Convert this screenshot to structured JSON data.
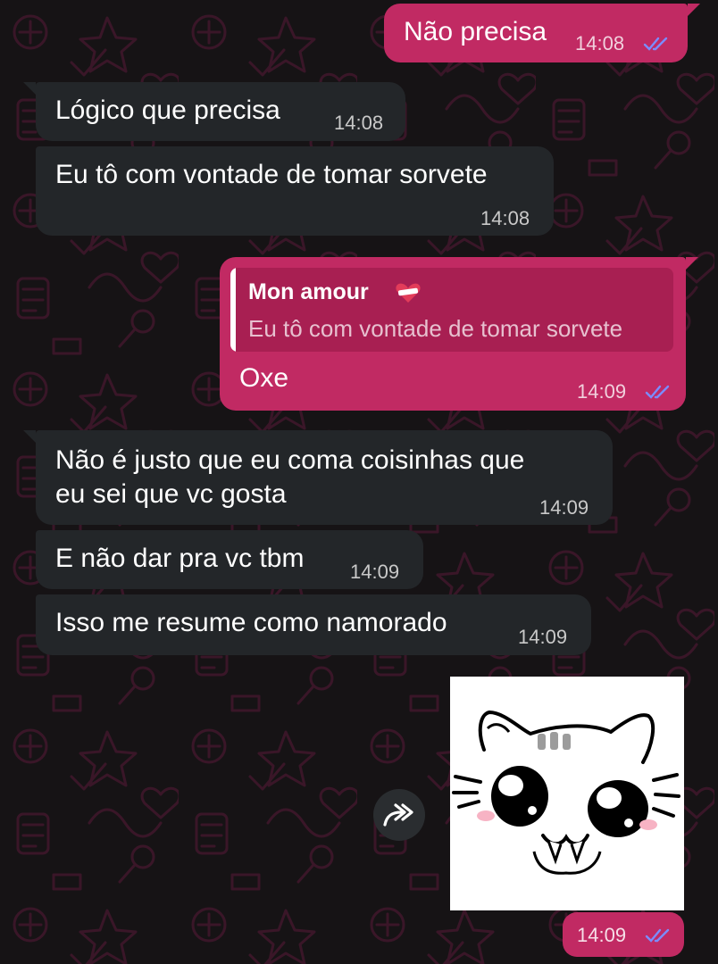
{
  "theme": {
    "incoming_bubble": "#232629",
    "outgoing_bubble": "#c12a63",
    "quote_background": "#a81f52",
    "read_ticks": "#7b8cff",
    "wallpaper_pattern": "#3a1628"
  },
  "messages": [
    {
      "direction": "outgoing",
      "text": "Não precisa",
      "time": "14:08",
      "status": "read"
    },
    {
      "direction": "incoming",
      "text": "Lógico que precisa",
      "time": "14:08"
    },
    {
      "direction": "incoming",
      "text": "Eu tô com vontade de tomar sorvete",
      "time": "14:08"
    },
    {
      "direction": "outgoing",
      "reply_to": {
        "author": "Mon amour",
        "author_icon": "mending-heart-icon",
        "text": "Eu tô com vontade de tomar sorvete"
      },
      "text": "Oxe",
      "time": "14:09",
      "status": "read"
    },
    {
      "direction": "incoming",
      "text_lines": [
        "Não é justo que eu coma coisinhas que",
        "eu sei que vc gosta"
      ],
      "time": "14:09"
    },
    {
      "direction": "incoming",
      "text": "E não dar pra vc tbm",
      "time": "14:09"
    },
    {
      "direction": "incoming",
      "text": "Isso me resume como namorado",
      "time": "14:09"
    },
    {
      "direction": "outgoing",
      "type": "sticker",
      "sticker": "cute-cat-sticker",
      "time": "14:09",
      "status": "read",
      "forward_icon": "forward-icon"
    }
  ]
}
